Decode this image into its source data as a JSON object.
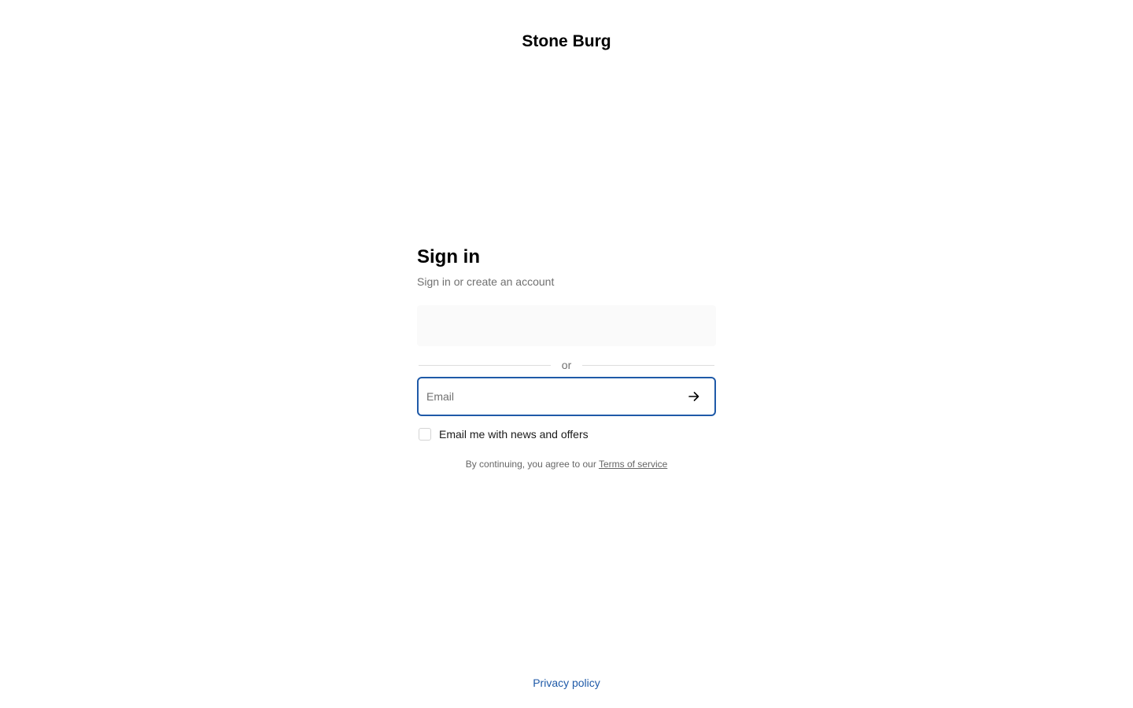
{
  "header": {
    "brand_name": "Stone Burg"
  },
  "signin": {
    "title": "Sign in",
    "subtitle": "Sign in or create an account",
    "divider_text": "or",
    "email_placeholder": "Email",
    "submit_icon": "arrow-right-icon",
    "newsletter_label": "Email me with news and offers",
    "newsletter_checked": false,
    "legal_prefix": "By continuing, you agree to our ",
    "terms_link": "Terms of service"
  },
  "footer": {
    "privacy_link": "Privacy policy"
  },
  "colors": {
    "accent": "#1f5aa8",
    "muted_text": "#707070",
    "divider": "#dedede"
  }
}
